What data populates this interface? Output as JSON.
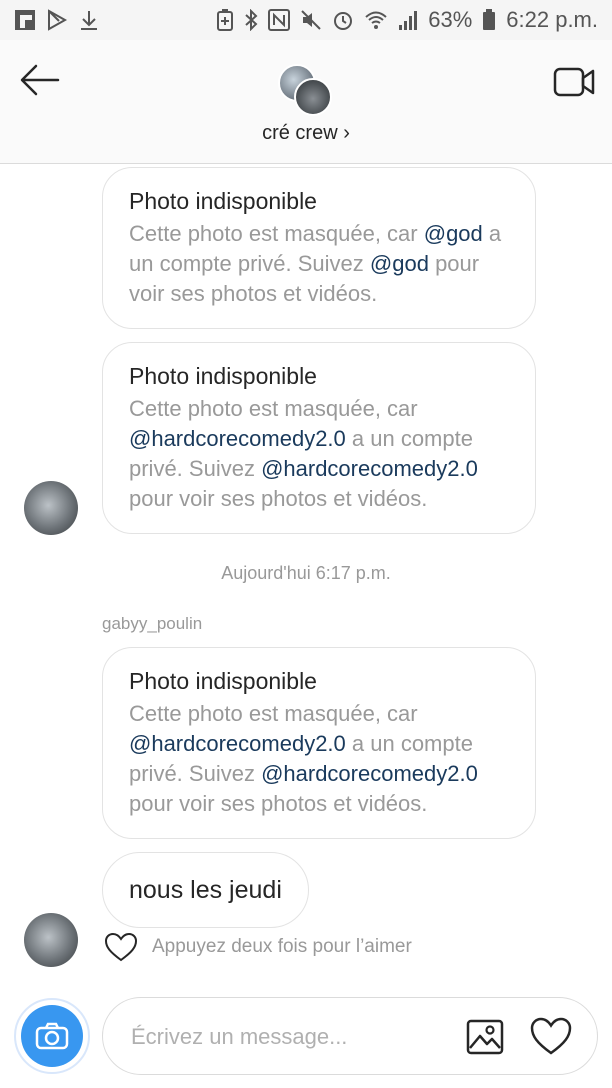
{
  "status_bar": {
    "battery": "63%",
    "time": "6:22 p.m.",
    "left_icons": [
      "flipboard-icon",
      "play-store-icon",
      "download-icon"
    ],
    "right_icons": [
      "battery-saver-icon",
      "bluetooth-icon",
      "nfc-icon",
      "mute-icon",
      "alarm-icon",
      "wifi-icon",
      "signal-icon",
      "battery-icon"
    ]
  },
  "header": {
    "title": "cré crew",
    "chevron": "›"
  },
  "messages": [
    {
      "title": "Photo indisponible",
      "parts": [
        "Cette photo est masquée, car ",
        "@god",
        " a un compte privé. Suivez ",
        "@god",
        " pour voir ses photos et vidéos."
      ]
    },
    {
      "title": "Photo indisponible",
      "parts": [
        "Cette photo est masquée, car ",
        "@hardcorecomedy2.0",
        " a un compte privé. Suivez ",
        "@hardcorecomedy2.0",
        " pour voir ses photos et vidéos."
      ]
    },
    {
      "title": "Photo indisponible",
      "parts": [
        "Cette photo est masquée, car ",
        "@hardcorecomedy2.0",
        " a un compte privé. Suivez ",
        "@hardcorecomedy2.0",
        " pour voir ses photos et vidéos."
      ]
    }
  ],
  "timestamp": "Aujourd'hui 6:17 p.m.",
  "sender": "gabyy_poulin",
  "text_message": "nous les jeudi",
  "like_hint": "Appuyez deux fois pour l’aimer",
  "composer": {
    "placeholder": "Écrivez un message..."
  },
  "colors": {
    "accent": "#3897f0",
    "mention": "#1a3a5c",
    "muted": "#999999"
  }
}
